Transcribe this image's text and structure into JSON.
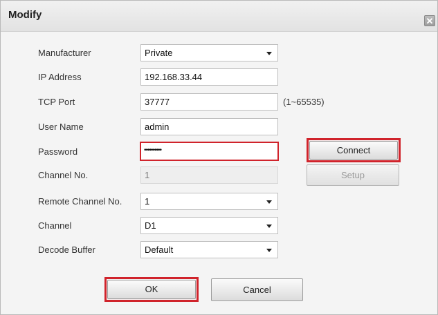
{
  "dialog": {
    "title": "Modify",
    "close_glyph": "✕"
  },
  "form": {
    "manufacturer": {
      "label": "Manufacturer",
      "value": "Private"
    },
    "ip_address": {
      "label": "IP Address",
      "value": "192.168.33.44"
    },
    "tcp_port": {
      "label": "TCP Port",
      "value": "37777",
      "hint": "(1~65535)"
    },
    "user_name": {
      "label": "User Name",
      "value": "admin"
    },
    "password": {
      "label": "Password",
      "value": "••••••••••"
    },
    "channel_no": {
      "label": "Channel No.",
      "value": "1"
    },
    "remote_channel_no": {
      "label": "Remote Channel No.",
      "value": "1"
    },
    "channel": {
      "label": "Channel",
      "value": "D1"
    },
    "decode_buffer": {
      "label": "Decode Buffer",
      "value": "Default"
    }
  },
  "buttons": {
    "connect": "Connect",
    "setup": "Setup",
    "ok": "OK",
    "cancel": "Cancel"
  },
  "colors": {
    "highlight": "#d0232b",
    "background": "#f4f4f4"
  },
  "icons": {
    "close": "close-icon",
    "dropdown": "chevron-down-icon"
  }
}
